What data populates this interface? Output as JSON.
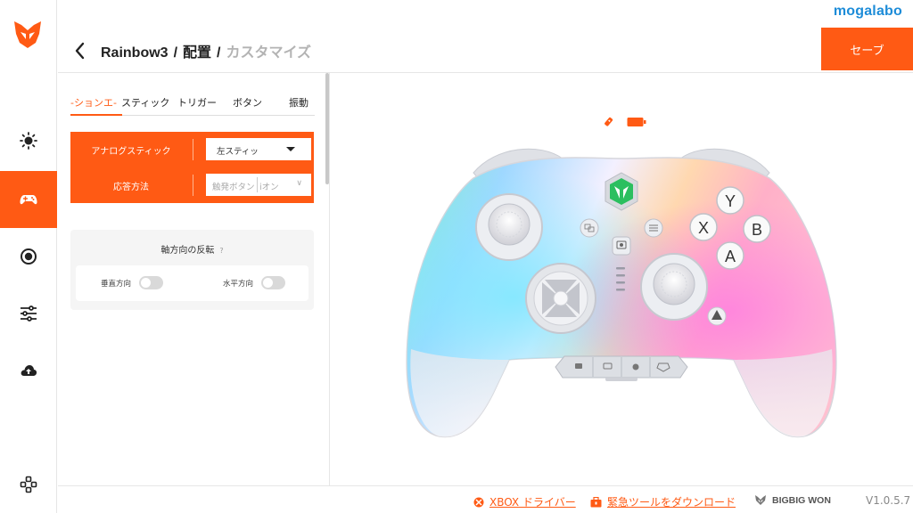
{
  "brand": {
    "name": "mogalabo"
  },
  "header": {
    "crumbs": [
      "Rainbow3",
      "配置",
      "カスタマイズ"
    ],
    "separator": "/",
    "save_label": "セーブ"
  },
  "sidebar": {
    "items": [
      {
        "icon": "brightness-icon",
        "active": false
      },
      {
        "icon": "gamepad-icon",
        "active": true
      },
      {
        "icon": "record-icon",
        "active": false
      },
      {
        "icon": "sliders-icon",
        "active": false
      },
      {
        "icon": "cloud-upload-icon",
        "active": false
      },
      {
        "icon": "controller-settings-icon",
        "active": false
      }
    ]
  },
  "tabs": [
    {
      "label": "-ションエ-",
      "active": true
    },
    {
      "label": "スティック",
      "active": false
    },
    {
      "label": "トリガー",
      "active": false
    },
    {
      "label": "ボタン",
      "active": false
    },
    {
      "label": "振動",
      "active": false
    }
  ],
  "form": {
    "stick_label": "アナログスティック",
    "stick_value": "左スティッ",
    "response_label": "応答方法",
    "response_value_a": "触発ボタン",
    "response_value_b": "iオン"
  },
  "invert": {
    "title": "軸方向の反転",
    "help": "?",
    "vertical_label": "垂直方向",
    "horizontal_label": "水平方向",
    "vertical_on": false,
    "horizontal_on": false
  },
  "controller_buttons": {
    "y": "Y",
    "x": "X",
    "b": "B",
    "a": "A"
  },
  "footer": {
    "xbox_driver": "XBOX ドライバー",
    "emergency_tool": "緊急ツールをダウンロード",
    "maker": "BIGBIG WON",
    "version": "V1.0.5.7"
  },
  "colors": {
    "accent": "#ff5a14",
    "brand_blue": "#1d8cd8"
  }
}
